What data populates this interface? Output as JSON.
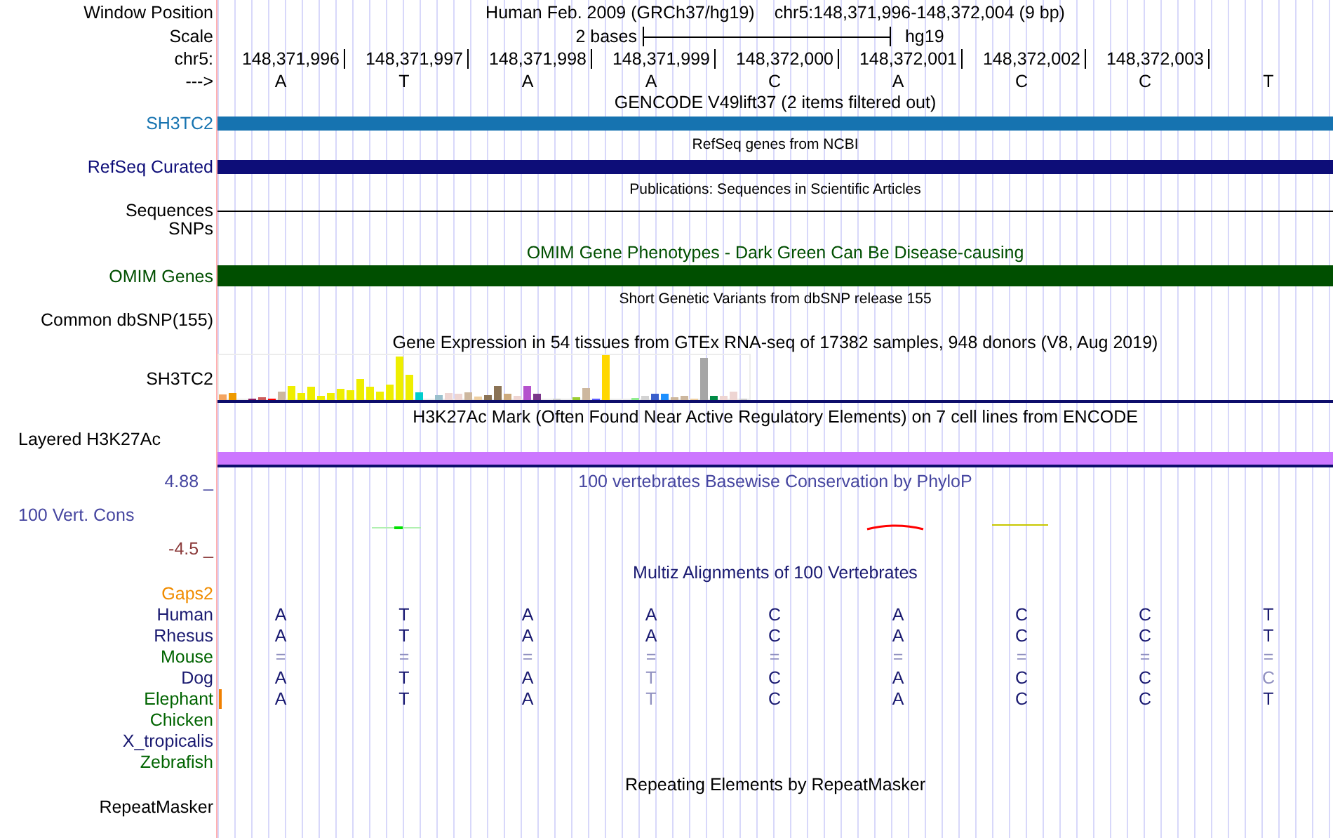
{
  "position_row": {
    "label": "Window Position",
    "genome": "Human Feb. 2009 (GRCh37/hg19)",
    "range": "chr5:148,371,996-148,372,004 (9 bp)"
  },
  "scale_row": {
    "label": "Scale",
    "span": "2 bases",
    "assembly": "hg19"
  },
  "ruler_row": {
    "label": "chr5:",
    "positions": [
      "148,371,996",
      "148,371,997",
      "148,371,998",
      "148,371,999",
      "148,372,000",
      "148,372,001",
      "148,372,002",
      "148,372,003"
    ]
  },
  "strand_row": {
    "label": "--->",
    "bases": [
      "A",
      "T",
      "A",
      "A",
      "C",
      "A",
      "C",
      "C",
      "T"
    ]
  },
  "tracks": [
    {
      "kind": "gene_full",
      "title": "GENCODE V49lift37 (2 items filtered out)",
      "label": "SH3TC2",
      "color": "#1673b0"
    },
    {
      "kind": "gene_dense",
      "title": "RefSeq genes from NCBI",
      "label": "RefSeq Curated",
      "color": "#0d0d78"
    },
    {
      "kind": "line_dense",
      "title": "Publications: Sequences in Scientific Articles",
      "label": "Sequences"
    },
    {
      "kind": "label_only",
      "label": "SNPs"
    },
    {
      "kind": "phenotype",
      "title": "OMIM Gene Phenotypes - Dark Green Can Be Disease-causing",
      "label": "OMIM Genes",
      "color": "#004f00"
    },
    {
      "kind": "label_dense",
      "title": "Short Genetic Variants from dbSNP release 155",
      "label": "Common dbSNP(155)"
    },
    {
      "kind": "expression",
      "title": "Gene Expression in 54 tissues from GTEx RNA-seq of 17382 samples, 948 donors (V8, Aug 2019)",
      "label": "SH3TC2"
    },
    {
      "kind": "signal",
      "title": "H3K27Ac Mark (Often Found Near Active Regulatory Elements) on 7 cell lines from ENCODE",
      "label": "Layered H3K27Ac",
      "color": "#cc77ff"
    },
    {
      "kind": "phylop",
      "title": "100 vertebrates Basewise Conservation by PhyloP",
      "upper": "4.88 _",
      "label": "100 Vert. Cons",
      "lower": "-4.5 _"
    },
    {
      "kind": "multiz",
      "title": "Multiz Alignments of 100 Vertebrates",
      "gaps_label": "Gaps2",
      "species": [
        {
          "name": "Human",
          "color": "#191970",
          "gap": false,
          "bases": [
            {
              "text": "A",
              "faded": false
            },
            {
              "text": "T",
              "faded": false
            },
            {
              "text": "A",
              "faded": false
            },
            {
              "text": "A",
              "faded": false
            },
            {
              "text": "C",
              "faded": false
            },
            {
              "text": "A",
              "faded": false
            },
            {
              "text": "C",
              "faded": false
            },
            {
              "text": "C",
              "faded": false
            },
            {
              "text": "T",
              "faded": false
            }
          ]
        },
        {
          "name": "Rhesus",
          "color": "#191970",
          "gap": false,
          "bases": [
            {
              "text": "A",
              "faded": false
            },
            {
              "text": "T",
              "faded": false
            },
            {
              "text": "A",
              "faded": false
            },
            {
              "text": "A",
              "faded": false
            },
            {
              "text": "C",
              "faded": false
            },
            {
              "text": "A",
              "faded": false
            },
            {
              "text": "C",
              "faded": false
            },
            {
              "text": "C",
              "faded": false
            },
            {
              "text": "T",
              "faded": false
            }
          ]
        },
        {
          "name": "Mouse",
          "color": "#006400",
          "gap": false,
          "bases": [
            {
              "text": "=",
              "faded": true
            },
            {
              "text": "=",
              "faded": true
            },
            {
              "text": "=",
              "faded": true
            },
            {
              "text": "=",
              "faded": true
            },
            {
              "text": "=",
              "faded": true
            },
            {
              "text": "=",
              "faded": true
            },
            {
              "text": "=",
              "faded": true
            },
            {
              "text": "=",
              "faded": true
            },
            {
              "text": "=",
              "faded": true
            }
          ]
        },
        {
          "name": "Dog",
          "color": "#191970",
          "gap": false,
          "bases": [
            {
              "text": "A",
              "faded": false
            },
            {
              "text": "T",
              "faded": false
            },
            {
              "text": "A",
              "faded": false
            },
            {
              "text": "T",
              "faded": true
            },
            {
              "text": "C",
              "faded": false
            },
            {
              "text": "A",
              "faded": false
            },
            {
              "text": "C",
              "faded": false
            },
            {
              "text": "C",
              "faded": false
            },
            {
              "text": "C",
              "faded": true
            }
          ]
        },
        {
          "name": "Elephant",
          "color": "#006400",
          "gap": true,
          "bases": [
            {
              "text": "A",
              "faded": false
            },
            {
              "text": "T",
              "faded": false
            },
            {
              "text": "A",
              "faded": false
            },
            {
              "text": "T",
              "faded": true
            },
            {
              "text": "C",
              "faded": false
            },
            {
              "text": "A",
              "faded": false
            },
            {
              "text": "C",
              "faded": false
            },
            {
              "text": "C",
              "faded": false
            },
            {
              "text": "T",
              "faded": false
            }
          ]
        },
        {
          "name": "Chicken",
          "color": "#006400",
          "gap": false
        },
        {
          "name": "X_tropicalis",
          "color": "#191970",
          "gap": false
        },
        {
          "name": "Zebrafish",
          "color": "#006400",
          "gap": false
        }
      ]
    },
    {
      "kind": "repeat",
      "title": "Repeating Elements by RepeatMasker",
      "label": "RepeatMasker"
    }
  ]
}
